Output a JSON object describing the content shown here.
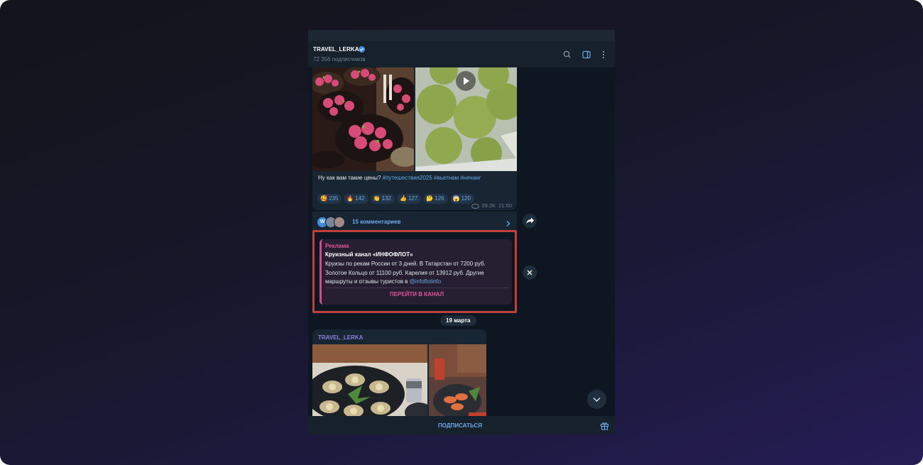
{
  "channel": {
    "title": "TRAVEL_LERKA",
    "subscribers": "72 356 подписчиков",
    "verified_icon": "verified-badge-icon"
  },
  "header_actions": [
    "search-icon",
    "sidebar-toggle-icon",
    "more-vertical-icon"
  ],
  "post": {
    "caption_text": "Ну как вам такие цены? ",
    "hashtags": "#путешествия2025 #вьетнам #нячанг",
    "reactions": [
      {
        "emoji": "🥰",
        "count": "235"
      },
      {
        "emoji": "🔥",
        "count": "142"
      },
      {
        "emoji": "👏",
        "count": "132"
      },
      {
        "emoji": "👍",
        "count": "127"
      },
      {
        "emoji": "🤔",
        "count": "126"
      },
      {
        "emoji": "😱",
        "count": "120"
      }
    ],
    "views": "29.2K",
    "time": "21:50",
    "comments_label": "15 комментариев",
    "avatar_letter": "W"
  },
  "ad": {
    "label": "Реклама",
    "title": "Круизный канал «ИНФОФЛОТ»",
    "text": "Круизы по рекам России от 3 дней. В Татарстан от 7200 руб. Золотое Кольцо от 11100 руб. Карелия от 13912 руб. Другие маршруты и отзывы туристов в ",
    "link": "@infoflotinfo",
    "button": "ПЕРЕЙТИ В КАНАЛ"
  },
  "date_divider": "19 марта",
  "post2": {
    "author": "TRAVEL_LERKA"
  },
  "bottom_bar": {
    "subscribe": "ПОДПИСАТЬСЯ",
    "gift_icon": "gift-icon"
  },
  "colors": {
    "accent": "#6aa9e9",
    "ad_accent": "#e0559a",
    "highlight_outline": "#c0413c",
    "chat_bg": "#0e1621"
  }
}
